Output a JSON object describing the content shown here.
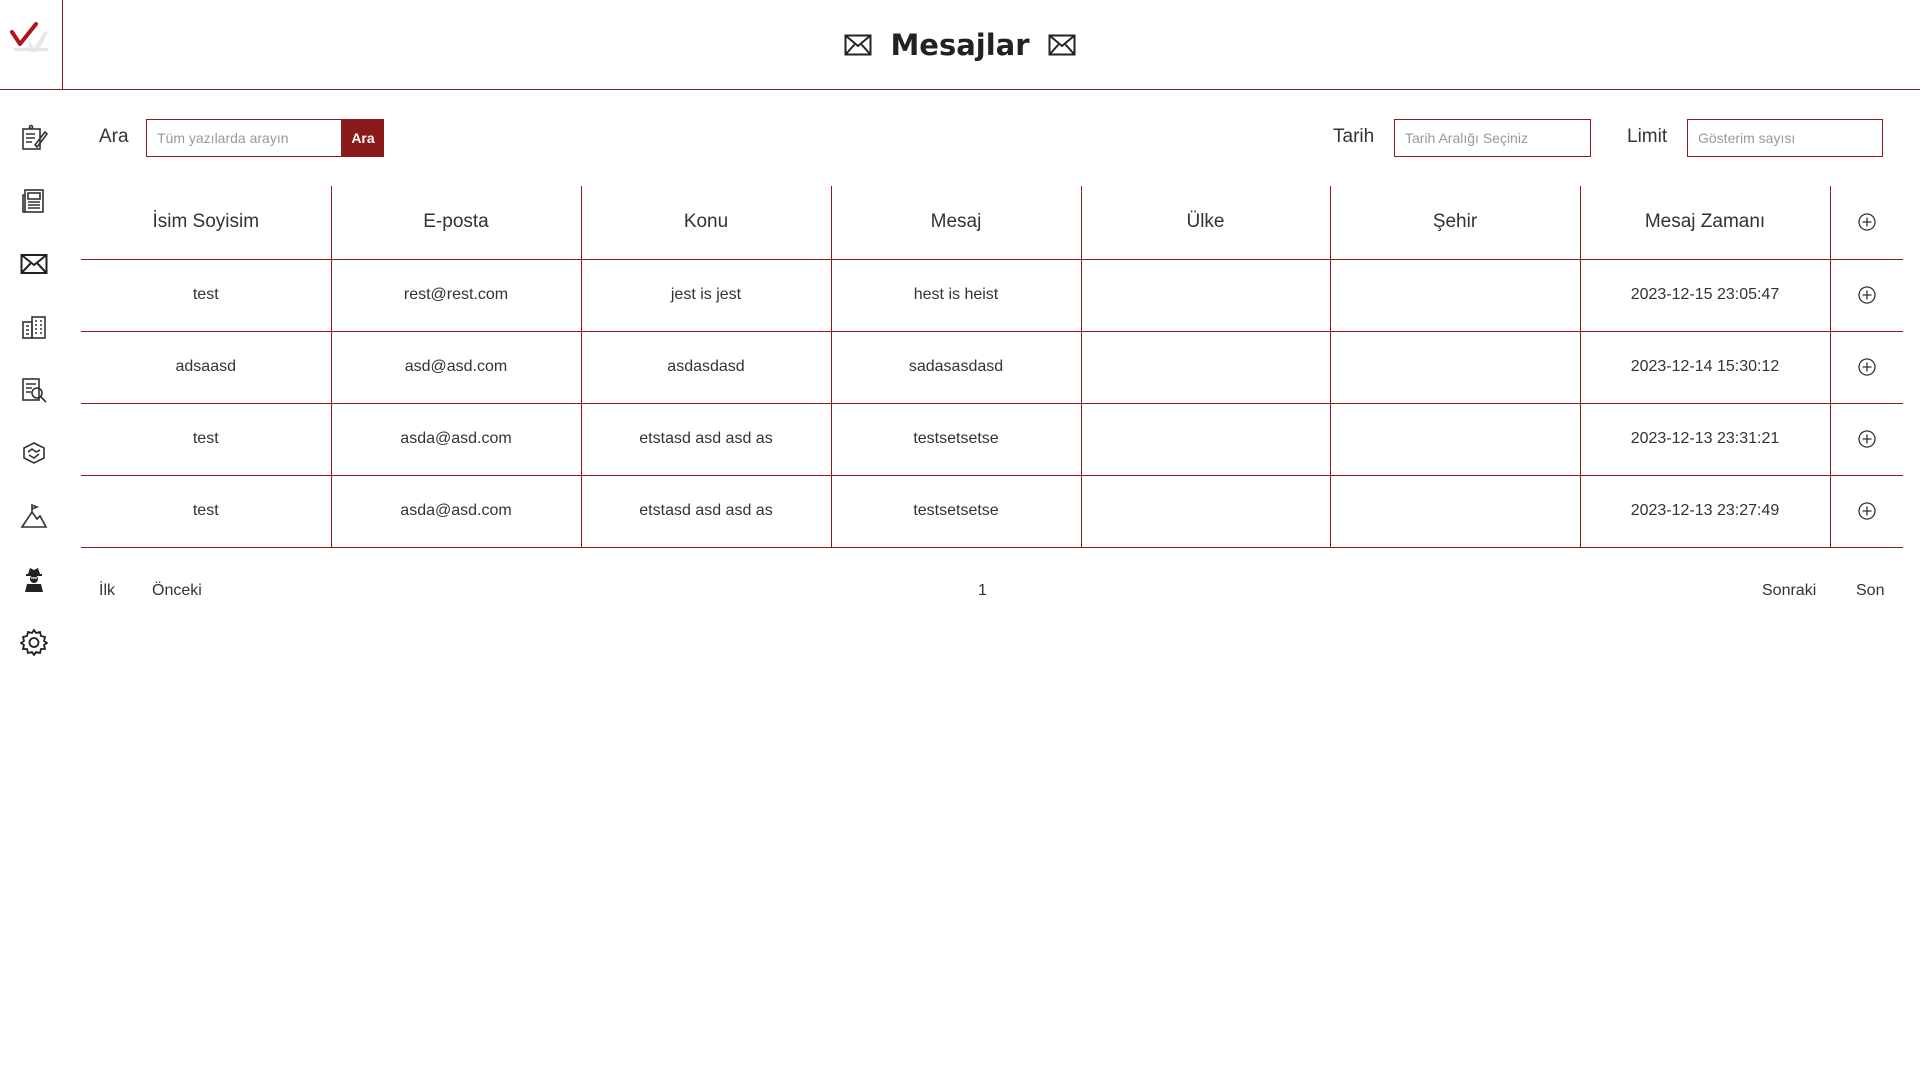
{
  "header": {
    "title": "Mesajlar",
    "left_icon": "envelope-icon",
    "right_icon": "envelope-icon",
    "logo": "brand-logo"
  },
  "sidebar": {
    "items": [
      {
        "icon": "document-edit-icon"
      },
      {
        "icon": "newspaper-icon"
      },
      {
        "icon": "envelope-icon"
      },
      {
        "icon": "building-icon"
      },
      {
        "icon": "document-search-icon"
      },
      {
        "icon": "handshake-icon"
      },
      {
        "icon": "mountain-flag-icon"
      },
      {
        "icon": "user-secret-icon"
      },
      {
        "icon": "gear-icon"
      }
    ]
  },
  "filters": {
    "search_label": "Ara",
    "search_placeholder": "Tüm yazılarda arayın",
    "search_button": "Ara",
    "date_label": "Tarih",
    "date_placeholder": "Tarih Aralığı Seçiniz",
    "limit_label": "Limit",
    "limit_placeholder": "Gösterim sayısı"
  },
  "table": {
    "columns": [
      "İsim Soyisim",
      "E-posta",
      "Konu",
      "Mesaj",
      "Ülke",
      "Şehir",
      "Mesaj Zamanı"
    ],
    "rows": [
      [
        "test",
        "rest@rest.com",
        "jest is jest",
        "hest is heist",
        "",
        "",
        "2023-12-15 23:05:47"
      ],
      [
        "adsaasd",
        "asd@asd.com",
        "asdasdasd",
        "sadasasdasd",
        "",
        "",
        "2023-12-14 15:30:12"
      ],
      [
        "test",
        "asda@asd.com",
        "etstasd asd asd as",
        "testsetsetse",
        "",
        "",
        "2023-12-13 23:31:21"
      ],
      [
        "test",
        "asda@asd.com",
        "etstasd asd asd as",
        "testsetsetse",
        "",
        "",
        "2023-12-13 23:27:49"
      ]
    ]
  },
  "pagination": {
    "first": "İlk",
    "prev": "Önceki",
    "page": "1",
    "next": "Sonraki",
    "last": "Son"
  },
  "colors": {
    "accent": "#8b1a1a",
    "text": "#333333",
    "placeholder": "#999999"
  }
}
